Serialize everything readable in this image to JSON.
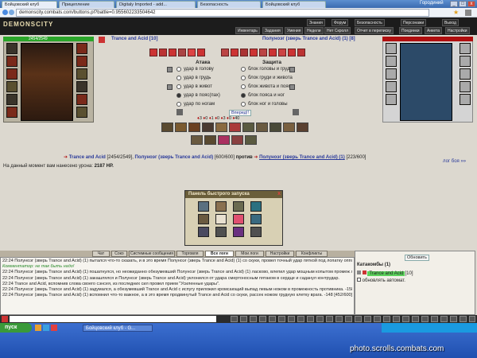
{
  "browser": {
    "tabs": [
      {
        "label": "Бойцовский клуб"
      },
      {
        "label": "Прицепление"
      },
      {
        "label": "Digitaly Imported - add..."
      },
      {
        "label": "Безопасность"
      },
      {
        "label": "Бойцовский клуб"
      }
    ],
    "url": "demonscity.combats.com/buttons.pl?battle=0.955602233504642",
    "user": "Городиний"
  },
  "header": {
    "logo": "DEMONSCITY",
    "nav_top": [
      "Знания",
      "Форум",
      "Безопасность",
      "Персонажи",
      "Выход"
    ],
    "nav_bottom": [
      "Инвентарь",
      "Задания",
      "Умения",
      "Недели",
      "Нет Скролл",
      "Отчет в переписку",
      "Поединки",
      "Анкета",
      "Настройки"
    ]
  },
  "left_char": {
    "hp": "2454/2549"
  },
  "battle": {
    "player_name": "Trance and Acid",
    "player_level": "[10]",
    "opponent_name": "Полуноэг (зверь Trance and Acid) (1)",
    "opponent_level": "[8]",
    "attack_label": "Атака",
    "defense_label": "Защита",
    "attack_options": [
      "удар в голову",
      "удар в грудь",
      "удар в живот",
      "удар в пояс(пах)",
      "удар по ногам"
    ],
    "defense_options": [
      "блок головы и груди",
      "блок груди и живота",
      "блок живота и пояса",
      "блок пояса и ног",
      "блок ног и головы"
    ],
    "forward_btn": "Вперед!!",
    "counters": [
      "3",
      "0",
      "1",
      "0",
      "3",
      "0",
      "40"
    ],
    "line": {
      "p1": "Trance and Acid",
      "p1_hp": "[2454/2549]",
      "p2": "Полуноэг (зверь Trance and Acid)",
      "p2_hp": "[600/600]",
      "vs": "против",
      "p3": "Полуноэг (зверь Trance and Acid) (1)",
      "p3_hp": "[223/600]",
      "log_link": "лог боя »»"
    },
    "damage_text": "На данный момент вам нанесено урона:",
    "damage_value": "2187 HP."
  },
  "quick_panel": {
    "title": "Панель быстрого запуска",
    "close": "x"
  },
  "chat": {
    "tabs": [
      "Чат",
      "Соко",
      "Системные сообщения",
      "Торговля",
      "Все логи",
      "Мои логи",
      "Настройки",
      "Конфликты"
    ],
    "active_tab": "Все логи",
    "lines": [
      "22:24 Полуноэг (зверь Trance and Acid) (1) пытался что-то сказать, и в это время Полуноэг (зверь Trance and Acid) (1) со скуки, провел точный удар пяткой под лопатку оппонента. -46 [223/600]",
      "Комментатор: не так быть надо!",
      "22:24 Полуноэг (зверь Trance and Acid) (1) пошатнулся, но неожиданно обезумевший Полуноэг (зверь Trance and Acid) (1) ласково, влепил удар мощным копытом промеж лопаток оппонента. -25 [269/600]",
      "22:24 Полуноэг (зверь Trance and Acid) (1) закашлялся и Полуноэг (зверь Trance and Acid) уклонился от удара смертоносным пятаком в сердце и саданул контрудар.",
      "22:24 Trance and Acid, вспомнив слова своего сэнсея, из последних сил провел прием \"Усиленные удары\".",
      "22:24 Полуноэг (зверь Trance and Acid) (1) задумался, а обезумевший Trance and Acid с испугу приложил кромсающий выпад левым ножом в промежность противника. -158 [294/600]",
      "22:24 Полуноэг (зверь Trance and Acid) (1) вспомнил что-то важное, а в это время продвинутый Trance and Acid со скуки, рассек ножом грудную клетку врага. -148 [452/600]"
    ]
  },
  "right_bottom": {
    "btn": "Обновить",
    "location": "Катакомбы (1)",
    "name": "Trance and Acid",
    "level": "[10]",
    "auto_update": "обновлять автомат."
  },
  "taskbar": {
    "start": "пуск",
    "item": "Бойцовский клуб - G...",
    "watermark": "photo.scrolls.combats.com"
  }
}
